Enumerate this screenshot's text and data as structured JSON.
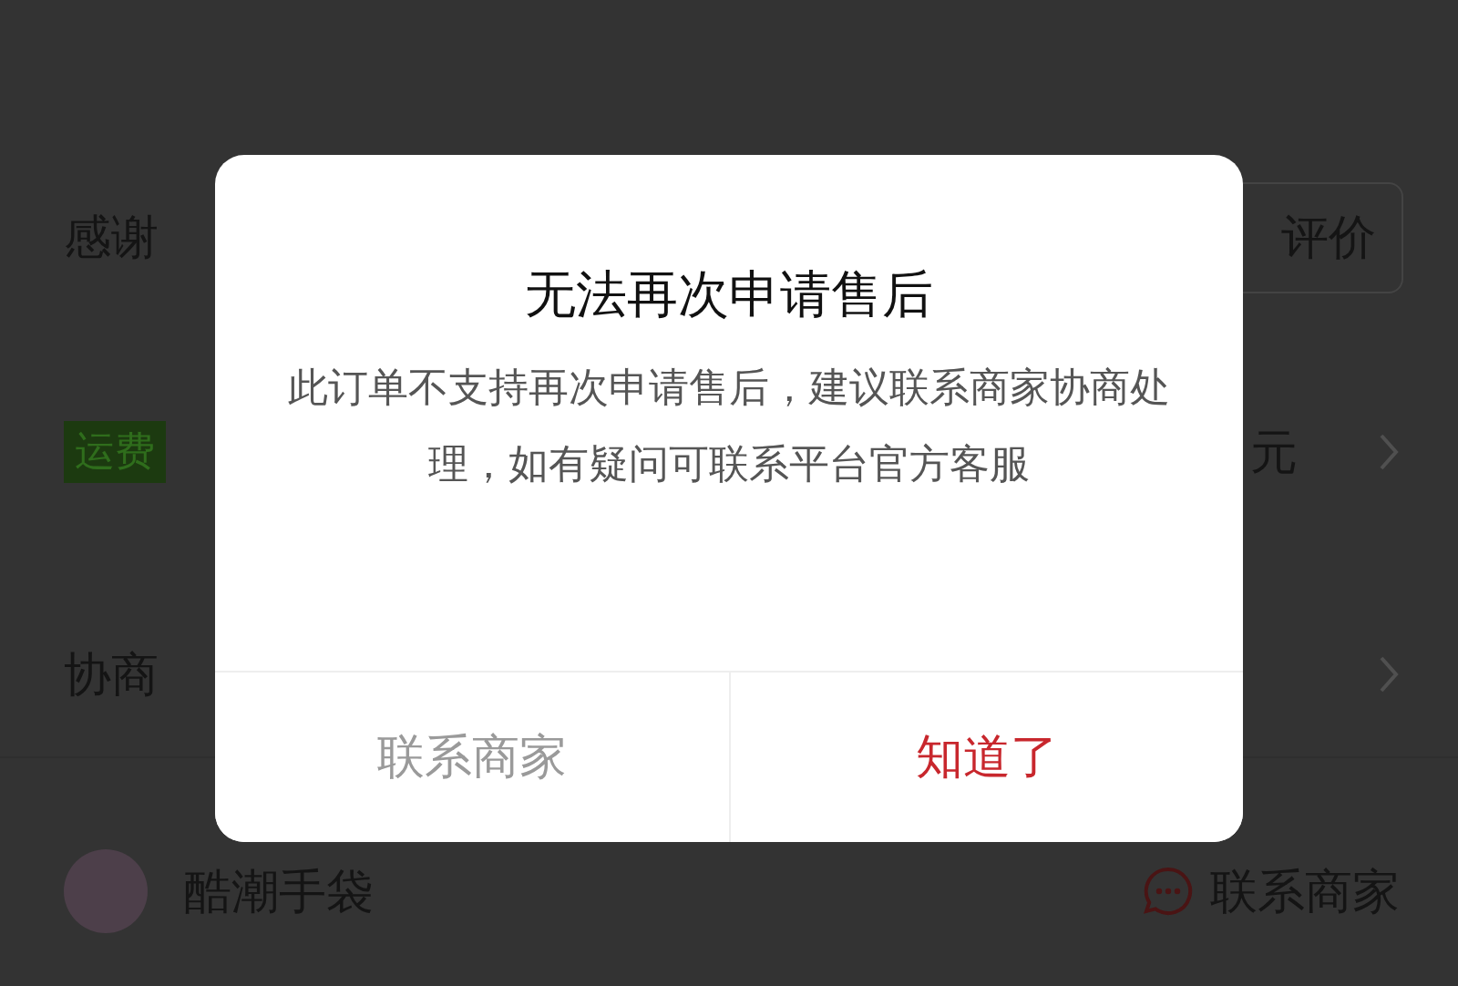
{
  "page": {
    "review_row": {
      "label": "感谢",
      "button": "评价"
    },
    "insurance_row": {
      "badge": "运费",
      "value": "元"
    },
    "negotiation_row": {
      "label": "协商"
    },
    "shop_row": {
      "name": "酷潮手袋",
      "contact": "联系商家"
    }
  },
  "dialog": {
    "title": "无法再次申请售后",
    "message": "此订单不支持再次申请售后，建议联系商家协商处理，如有疑问可联系平台官方客服",
    "buttons": [
      {
        "label": "联系商家",
        "kind": "secondary"
      },
      {
        "label": "知道了",
        "kind": "primary"
      }
    ]
  }
}
